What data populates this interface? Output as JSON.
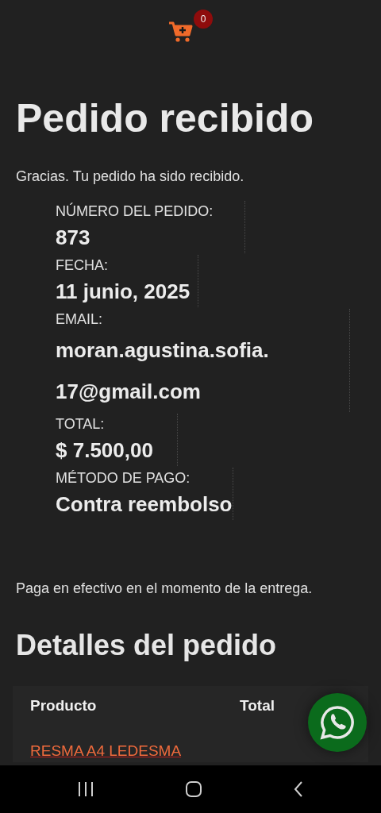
{
  "header": {
    "cart_count": "0"
  },
  "title": "Pedido recibido",
  "notice": "Gracias. Tu pedido ha sido recibido.",
  "order_overview": [
    {
      "label": "NÚMERO DEL PEDIDO:",
      "value": "873"
    },
    {
      "label": "FECHA:",
      "value": "11 junio, 2025"
    },
    {
      "label": "EMAIL:",
      "value": "moran.agustina.sofia.17@gmail.com"
    },
    {
      "label": "TOTAL:",
      "value": "$ 7.500,00"
    },
    {
      "label": "MÉTODO DE PAGO:",
      "value": "Contra reembolso"
    }
  ],
  "payment_note": "Paga en efectivo en el momento de la entrega.",
  "details": {
    "title": "Detalles del pedido",
    "columns": [
      "Producto",
      "Total"
    ],
    "rows": [
      {
        "product": "RESMA A4 LEDESMA"
      }
    ]
  }
}
